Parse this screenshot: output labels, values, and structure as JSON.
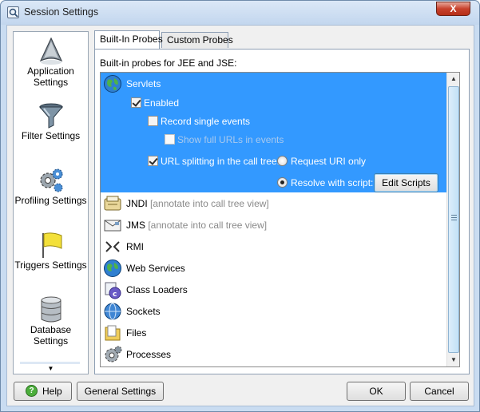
{
  "window": {
    "title": "Session Settings",
    "close_label": "X"
  },
  "sidebar": {
    "items": [
      {
        "label": "Application Settings",
        "icon": "application-icon"
      },
      {
        "label": "Filter Settings",
        "icon": "funnel-icon"
      },
      {
        "label": "Profiling Settings",
        "icon": "gears-icon"
      },
      {
        "label": "Triggers Settings",
        "icon": "flag-icon"
      },
      {
        "label": "Database Settings",
        "icon": "database-icon"
      }
    ],
    "scroll_down_glyph": "▼"
  },
  "tabs": [
    {
      "label": "Built-In Probes",
      "active": true
    },
    {
      "label": "Custom Probes",
      "active": false
    }
  ],
  "panel": {
    "caption": "Built-in probes for JEE and JSE:",
    "servlets": {
      "name": "Servlets",
      "enabled_label": "Enabled",
      "record_single_label": "Record single events",
      "show_full_urls_label": "Show full URLs in events",
      "url_splitting_label": "URL splitting in the call tree:",
      "radio_request_uri": "Request URI only",
      "radio_resolve_script": "Resolve with script:",
      "edit_scripts_label": "Edit Scripts",
      "enabled": true,
      "record_single": false,
      "show_full_urls": false,
      "url_splitting": true,
      "selected_radio": "resolve"
    },
    "probes": [
      {
        "name": "JNDI",
        "hint": "[annotate into call tree view]",
        "icon": "jndi-icon"
      },
      {
        "name": "JMS",
        "hint": "[annotate into call tree view]",
        "icon": "jms-icon"
      },
      {
        "name": "RMI",
        "hint": "",
        "icon": "rmi-icon"
      },
      {
        "name": "Web Services",
        "hint": "",
        "icon": "globe-icon"
      },
      {
        "name": "Class Loaders",
        "hint": "",
        "icon": "class-loader-icon"
      },
      {
        "name": "Sockets",
        "hint": "",
        "icon": "sockets-icon"
      },
      {
        "name": "Files",
        "hint": "",
        "icon": "files-icon"
      },
      {
        "name": "Processes",
        "hint": "",
        "icon": "processes-icon"
      }
    ],
    "scroll_up_glyph": "▲",
    "scroll_down_glyph": "▼"
  },
  "buttons": {
    "help": "Help",
    "general_settings": "General Settings",
    "ok": "OK",
    "cancel": "Cancel"
  },
  "colors": {
    "selection": "#3399ff",
    "hint_text": "#8a8a8a"
  }
}
